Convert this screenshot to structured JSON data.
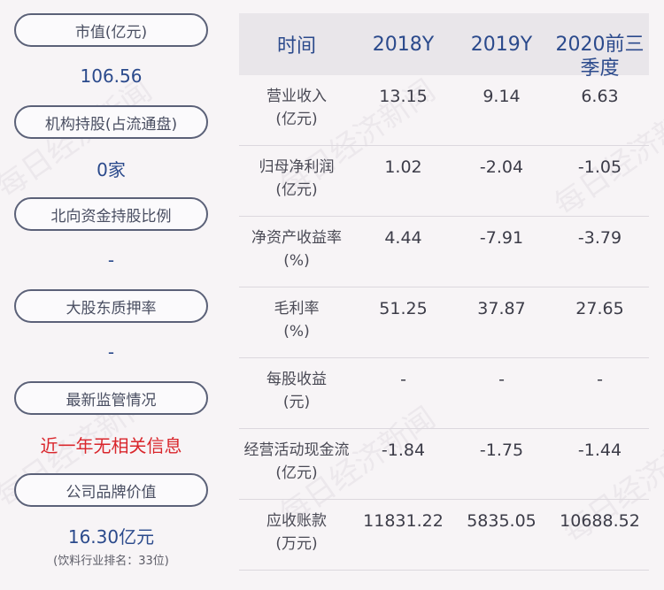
{
  "left": [
    {
      "label": "市值(亿元)",
      "value": "106.56"
    },
    {
      "label": "机构持股(占流通盘)",
      "value": "0家"
    },
    {
      "label": "北向资金持股比例",
      "value": "-"
    },
    {
      "label": "大股东质押率",
      "value": "-"
    },
    {
      "label": "最新监管情况",
      "value": "近一年无相关信息",
      "value_color": "#d9262c"
    },
    {
      "label": "公司品牌价值",
      "value": "16.30亿元",
      "note": "(饮料行业排名：33位)"
    }
  ],
  "table": {
    "headers": [
      "时间",
      "2018Y",
      "2019Y",
      "2020前三季度"
    ],
    "rows": [
      {
        "name": "营业收入",
        "unit": "(亿元)",
        "values": [
          "13.15",
          "9.14",
          "6.63"
        ]
      },
      {
        "name": "归母净利润",
        "unit": "(亿元)",
        "values": [
          "1.02",
          "-2.04",
          "-1.05"
        ]
      },
      {
        "name": "净资产收益率",
        "unit": "(%)",
        "values": [
          "4.44",
          "-7.91",
          "-3.79"
        ]
      },
      {
        "name": "毛利率",
        "unit": "(%)",
        "values": [
          "51.25",
          "37.87",
          "27.65"
        ]
      },
      {
        "name": "每股收益",
        "unit": "(元)",
        "values": [
          "-",
          "-",
          "-"
        ]
      },
      {
        "name": "经营活动现金流",
        "unit": "(亿元)",
        "values": [
          "-1.84",
          "-1.75",
          "-1.44"
        ]
      },
      {
        "name": "应收账款",
        "unit": "(万元)",
        "values": [
          "11831.22",
          "5835.05",
          "10688.52"
        ]
      }
    ]
  },
  "watermark": "每日经济新闻"
}
